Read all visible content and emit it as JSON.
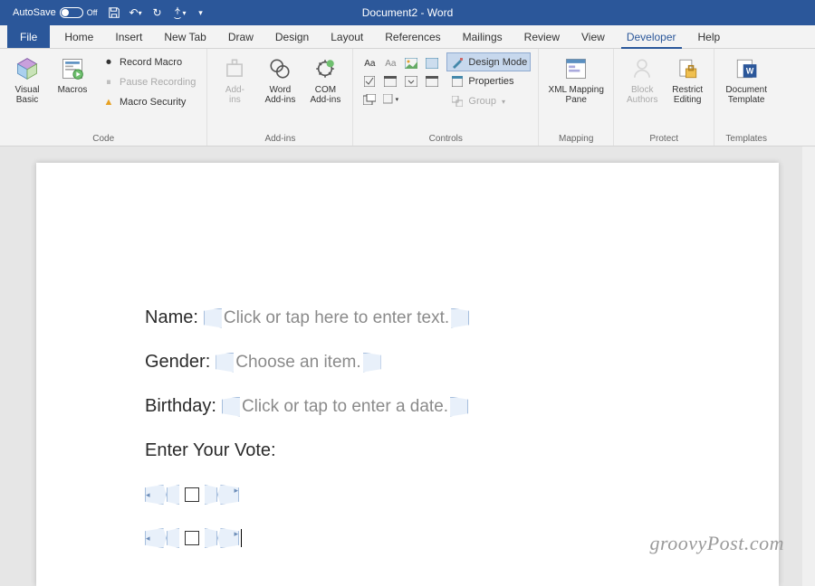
{
  "titlebar": {
    "autosave_label": "AutoSave",
    "autosave_state": "Off",
    "title": "Document2 - Word"
  },
  "tabs": [
    "File",
    "Home",
    "Insert",
    "New Tab",
    "Draw",
    "Design",
    "Layout",
    "References",
    "Mailings",
    "Review",
    "View",
    "Developer",
    "Help"
  ],
  "active_tab": "Developer",
  "ribbon": {
    "code": {
      "label": "Code",
      "visual_basic": "Visual\nBasic",
      "macros": "Macros",
      "record": "Record Macro",
      "pause": "Pause Recording",
      "security": "Macro Security"
    },
    "addins": {
      "label": "Add-ins",
      "addins": "Add-\nins",
      "word_addins": "Word\nAdd-ins",
      "com_addins": "COM\nAdd-ins"
    },
    "controls": {
      "label": "Controls",
      "design_mode": "Design Mode",
      "properties": "Properties",
      "group": "Group"
    },
    "mapping": {
      "label": "Mapping",
      "xml": "XML Mapping\nPane"
    },
    "protect": {
      "label": "Protect",
      "block": "Block\nAuthors",
      "restrict": "Restrict\nEditing"
    },
    "templates": {
      "label": "Templates",
      "doc_template": "Document\nTemplate"
    }
  },
  "form": {
    "name_label": "Name:",
    "name_ph": "Click or tap here to enter text.",
    "gender_label": "Gender:",
    "gender_ph": "Choose an item.",
    "birthday_label": "Birthday:",
    "birthday_ph": "Click or tap to enter a date.",
    "vote_label": "Enter Your Vote:"
  },
  "watermark": "groovyPost.com"
}
